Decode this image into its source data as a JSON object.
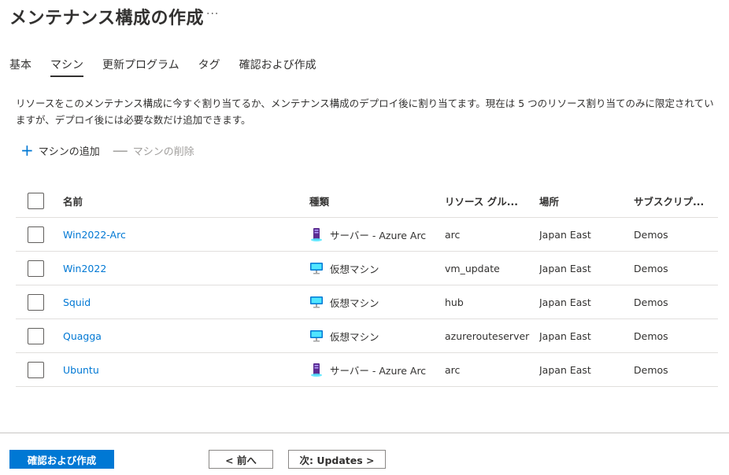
{
  "header": {
    "title": "メンテナンス構成の作成",
    "more": "···"
  },
  "tabs": [
    {
      "label": "基本"
    },
    {
      "label": "マシン"
    },
    {
      "label": "更新プログラム"
    },
    {
      "label": "タグ"
    },
    {
      "label": "確認および作成"
    }
  ],
  "description": "リソースをこのメンテナンス構成に今すぐ割り当てるか、メンテナンス構成のデプロイ後に割り当てます。現在は 5 つのリソース割り当てのみに限定されていますが、デプロイ後には必要な数だけ追加できます。",
  "toolbar": {
    "add_label": "マシンの追加",
    "remove_label": "マシンの削除"
  },
  "table": {
    "columns": [
      "名前",
      "種類",
      "リソース グル...",
      "場所",
      "サブスクリプ..."
    ],
    "rows": [
      {
        "name": "Win2022-Arc",
        "type": "サーバー - Azure Arc",
        "type_icon": "server-icon",
        "rg": "arc",
        "location": "Japan East",
        "subscription": "Demos"
      },
      {
        "name": "Win2022",
        "type": "仮想マシン",
        "type_icon": "virtual-machine-icon",
        "rg": "vm_update",
        "location": "Japan East",
        "subscription": "Demos"
      },
      {
        "name": "Squid",
        "type": "仮想マシン",
        "type_icon": "virtual-machine-icon",
        "rg": "hub",
        "location": "Japan East",
        "subscription": "Demos"
      },
      {
        "name": "Quagga",
        "type": "仮想マシン",
        "type_icon": "virtual-machine-icon",
        "rg": "azurerouteserver",
        "location": "Japan East",
        "subscription": "Demos"
      },
      {
        "name": "Ubuntu",
        "type": "サーバー - Azure Arc",
        "type_icon": "server-icon",
        "rg": "arc",
        "location": "Japan East",
        "subscription": "Demos"
      }
    ]
  },
  "footer": {
    "review_create": "確認および作成",
    "prev": "< 前へ",
    "next": "次: Updates >"
  },
  "colors": {
    "accent": "#0078d4",
    "text": "#323130",
    "disabled": "#a19f9d",
    "border": "#e1dfdd"
  }
}
